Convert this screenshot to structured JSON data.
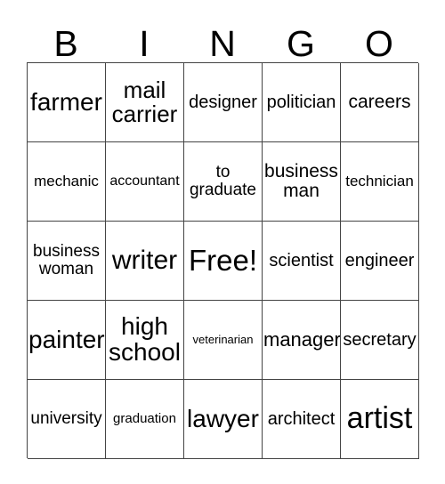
{
  "card": {
    "header_letters": [
      "B",
      "I",
      "N",
      "G",
      "O"
    ],
    "columns": 5,
    "rows": 5,
    "free_space_label": "Free!",
    "free_space_position": {
      "row": 3,
      "column": 3
    },
    "cells": [
      [
        {
          "text": "farmer",
          "size": "fs-28"
        },
        {
          "text": "mail\ncarrier",
          "size": "fs-26"
        },
        {
          "text": "designer",
          "size": "fs-20"
        },
        {
          "text": "politician",
          "size": "fs-20"
        },
        {
          "text": "careers",
          "size": "fs-21"
        }
      ],
      [
        {
          "text": "mechanic",
          "size": "fs-17"
        },
        {
          "text": "accountant",
          "size": "fs-16"
        },
        {
          "text": "to\ngraduate",
          "size": "fs-19"
        },
        {
          "text": "business\nman",
          "size": "fs-21"
        },
        {
          "text": "technician",
          "size": "fs-17"
        }
      ],
      [
        {
          "text": "business\nwoman",
          "size": "fs-19"
        },
        {
          "text": "writer",
          "size": "fs-30"
        },
        {
          "text": "Free!",
          "size": "fs-33"
        },
        {
          "text": "scientist",
          "size": "fs-20"
        },
        {
          "text": "engineer",
          "size": "fs-20"
        }
      ],
      [
        {
          "text": "painter",
          "size": "fs-28"
        },
        {
          "text": "high\nschool",
          "size": "fs-28"
        },
        {
          "text": "veterinarian",
          "size": "fs-13"
        },
        {
          "text": "manager",
          "size": "fs-22"
        },
        {
          "text": "secretary",
          "size": "fs-20"
        }
      ],
      [
        {
          "text": "university",
          "size": "fs-19"
        },
        {
          "text": "graduation",
          "size": "fs-15"
        },
        {
          "text": "lawyer",
          "size": "fs-28"
        },
        {
          "text": "architect",
          "size": "fs-20"
        },
        {
          "text": "artist",
          "size": "fs-34"
        }
      ]
    ]
  },
  "colors": {
    "background": "#ffffff",
    "cell_background": "#ffffff",
    "border": "#444444",
    "text": "#000000"
  }
}
